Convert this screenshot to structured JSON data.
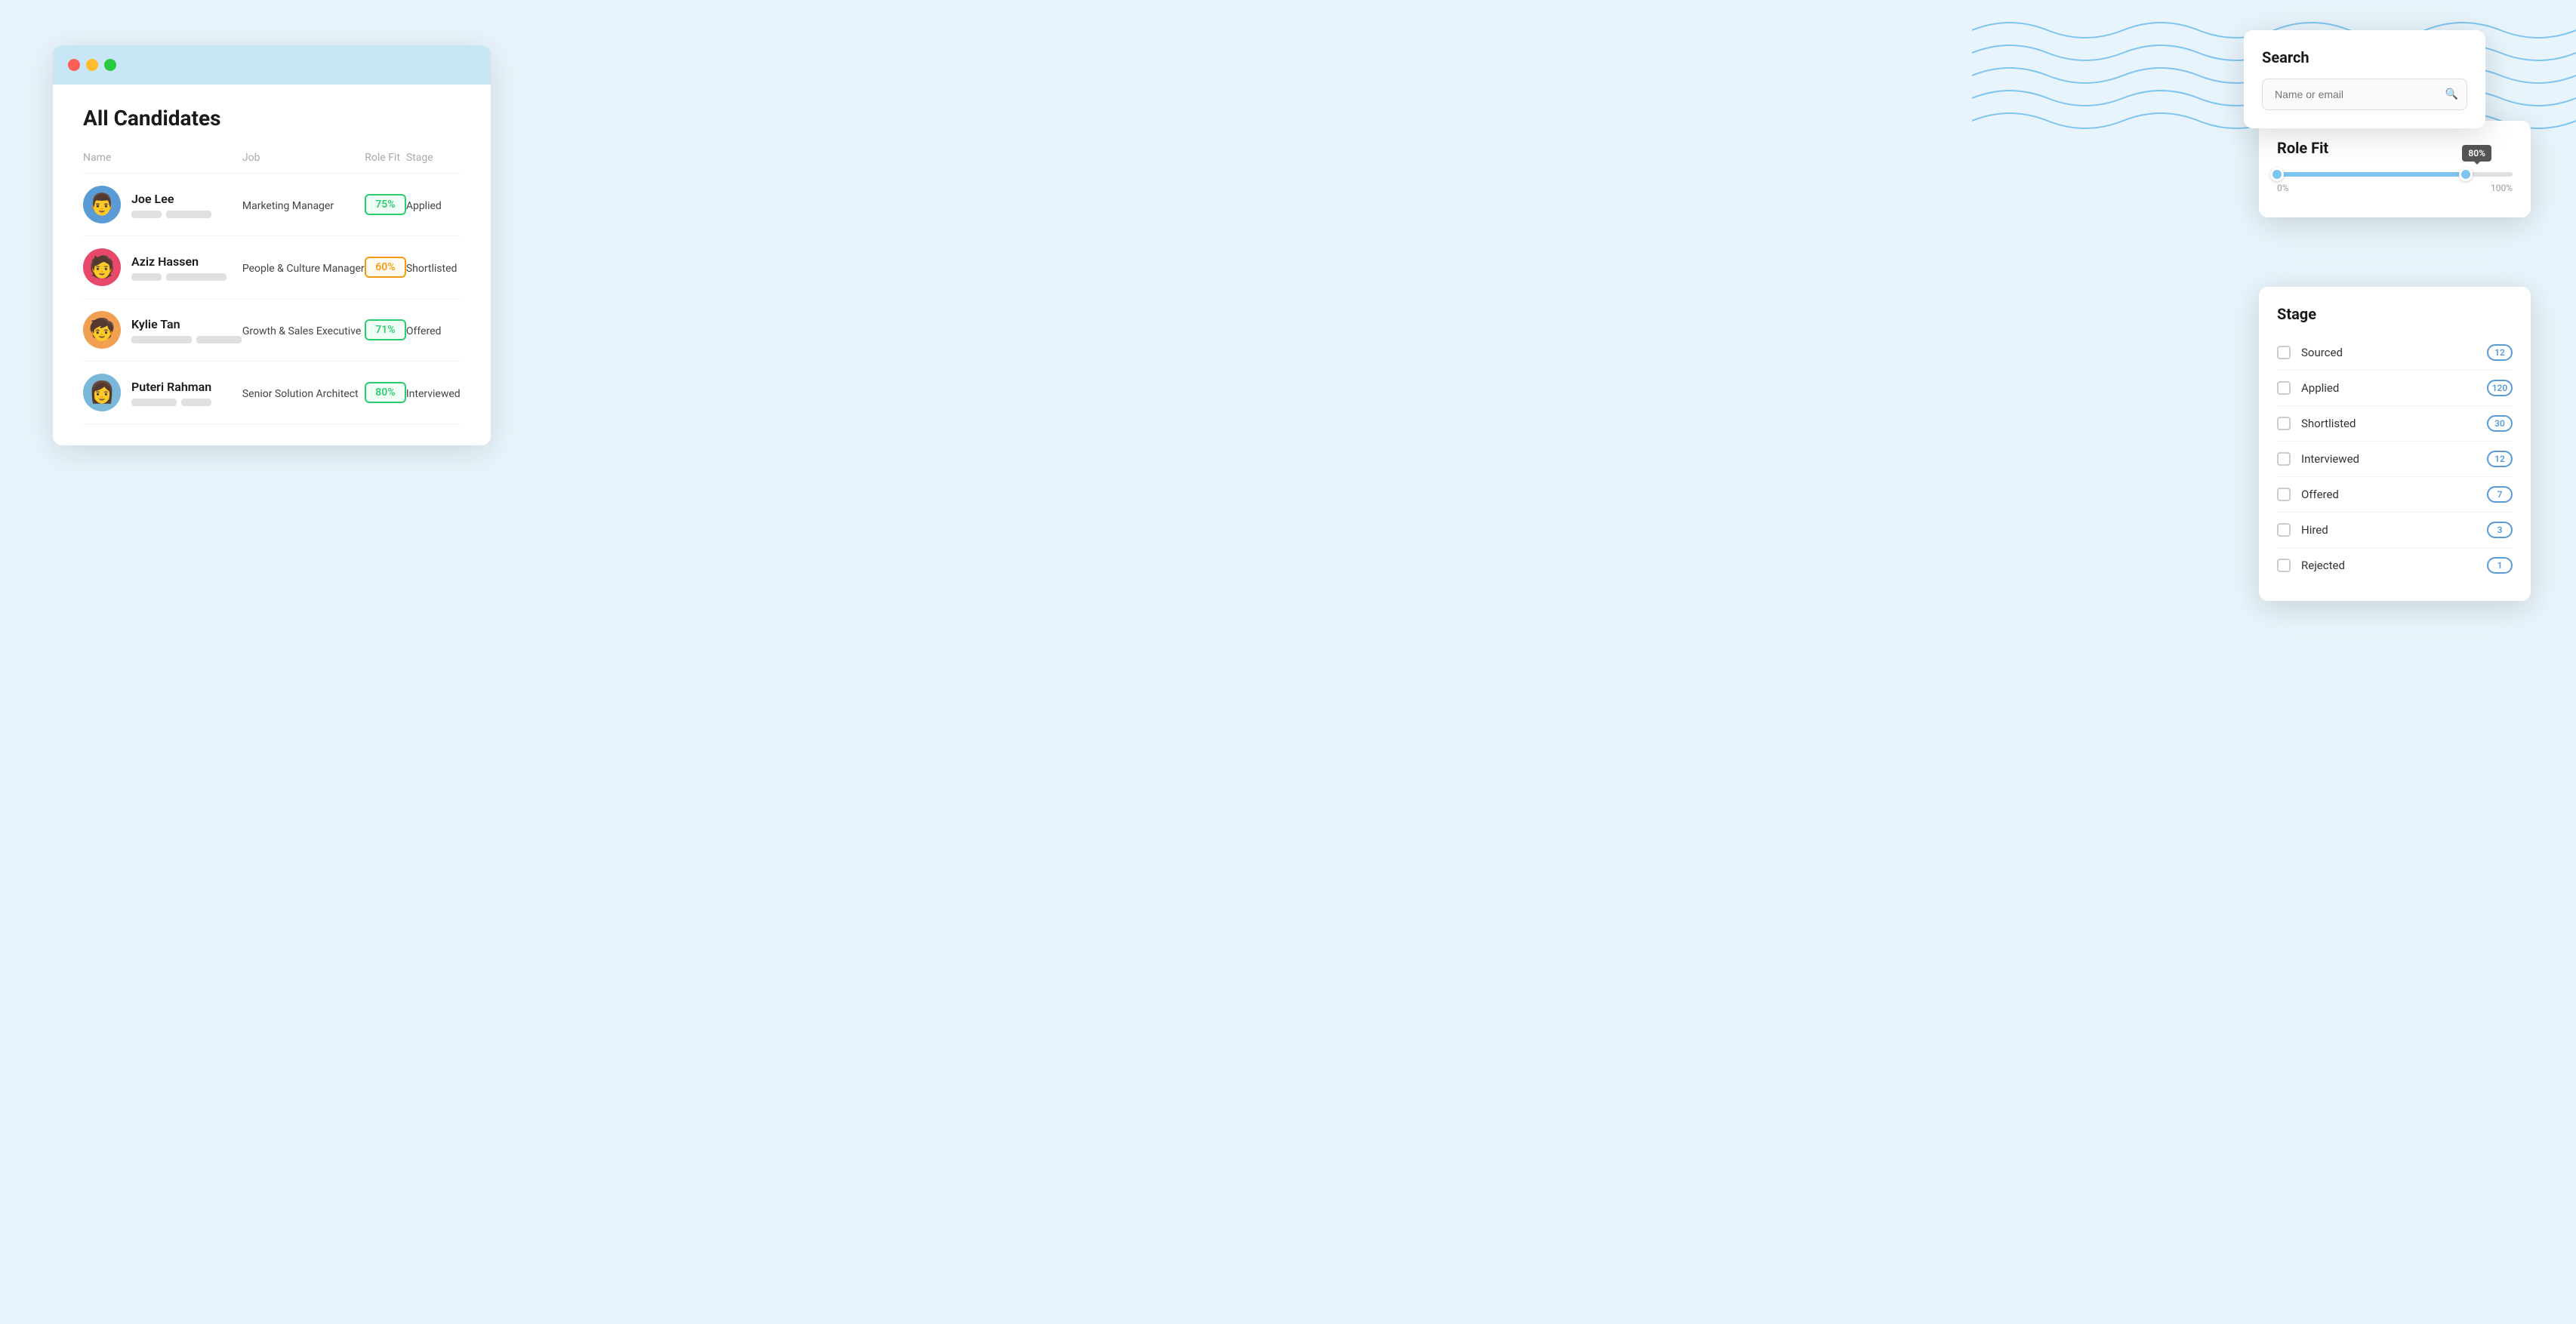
{
  "browser": {
    "titlebar": {
      "lights": [
        "red",
        "yellow",
        "green"
      ]
    }
  },
  "page": {
    "title": "All Candidates"
  },
  "table": {
    "columns": [
      "Name",
      "Job",
      "Role Fit",
      "Stage"
    ],
    "rows": [
      {
        "name": "Joe Lee",
        "job": "Marketing Manager",
        "roleFit": "75%",
        "roleFitColor": "green",
        "stage": "Applied",
        "avatarBg": "blue",
        "avatarEmoji": "👨‍💼",
        "tags": [
          "short",
          "medium"
        ]
      },
      {
        "name": "Aziz Hassen",
        "job": "People & Culture Manager",
        "roleFit": "60%",
        "roleFitColor": "orange",
        "stage": "Shortlisted",
        "avatarBg": "red",
        "avatarEmoji": "👨",
        "tags": [
          "short",
          "long"
        ]
      },
      {
        "name": "Kylie Tan",
        "job": "Growth & Sales Executive",
        "roleFit": "71%",
        "roleFitColor": "green",
        "stage": "Offered",
        "avatarBg": "orange",
        "avatarEmoji": "👦",
        "tags": [
          "long",
          "medium"
        ]
      },
      {
        "name": "Puteri Rahman",
        "job": "Senior Solution Architect",
        "roleFit": "80%",
        "roleFitColor": "green",
        "stage": "Interviewed",
        "avatarBg": "lightblue",
        "avatarEmoji": "👩",
        "tags": [
          "medium",
          "short"
        ]
      }
    ]
  },
  "search": {
    "title": "Search",
    "placeholder": "Name or email"
  },
  "roleFit": {
    "title": "Role Fit",
    "tooltipValue": "80%",
    "min": "0%",
    "max": "100%",
    "leftThumb": 0,
    "rightThumb": 80
  },
  "stage": {
    "title": "Stage",
    "items": [
      {
        "label": "Sourced",
        "count": "12"
      },
      {
        "label": "Applied",
        "count": "120"
      },
      {
        "label": "Shortlisted",
        "count": "30"
      },
      {
        "label": "Interviewed",
        "count": "12"
      },
      {
        "label": "Offered",
        "count": "7"
      },
      {
        "label": "Hired",
        "count": "3"
      },
      {
        "label": "Rejected",
        "count": "1"
      }
    ]
  }
}
